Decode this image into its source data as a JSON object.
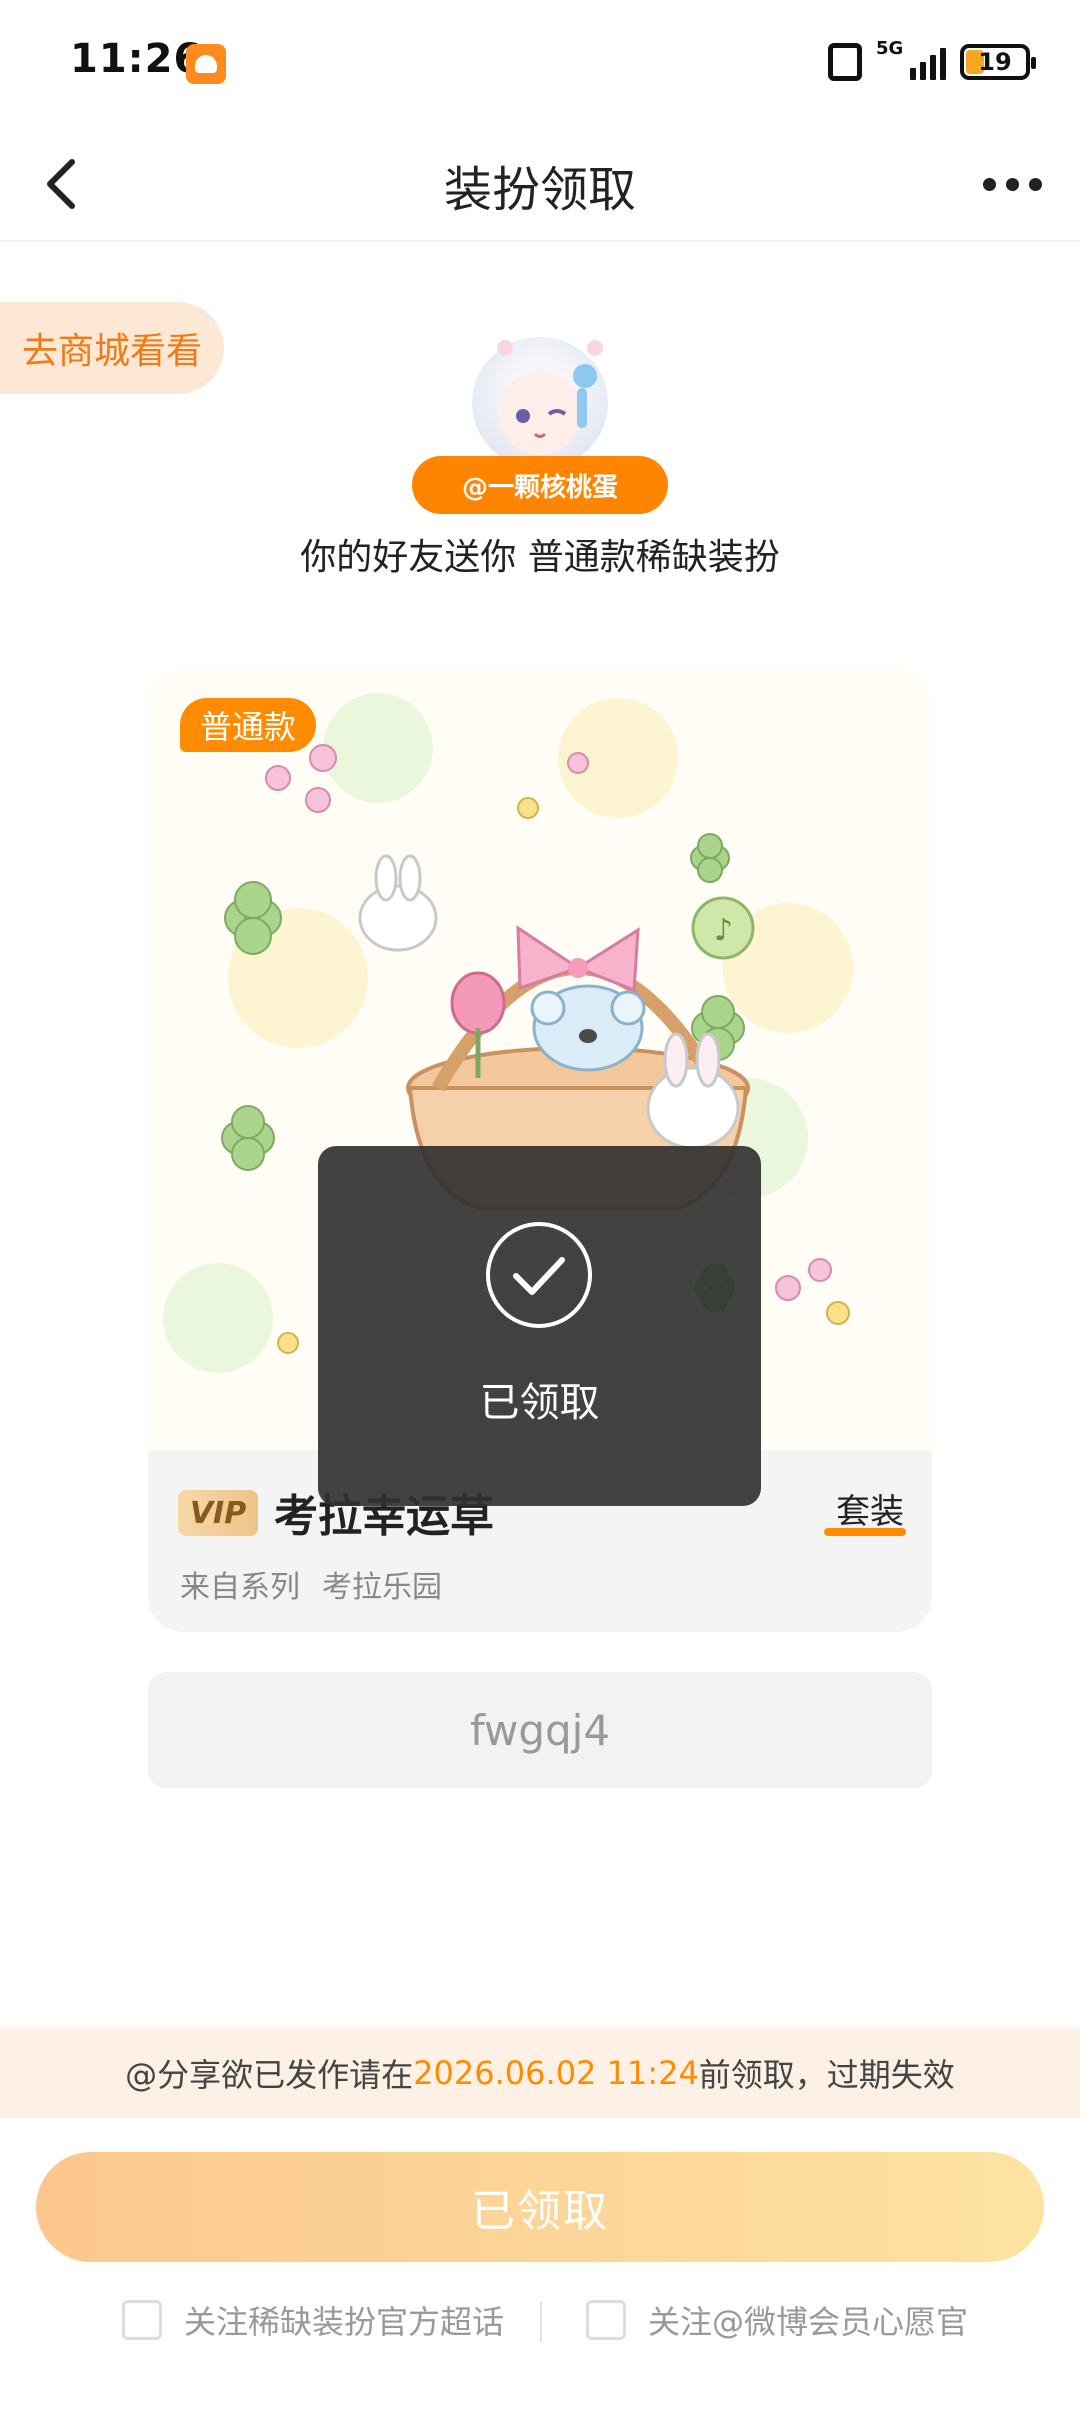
{
  "status_bar": {
    "time": "11:26",
    "network": "5G",
    "battery": "19",
    "icons": [
      "app-notification-icon",
      "vibrate-icon",
      "signal-icon",
      "battery-icon"
    ]
  },
  "header": {
    "title": "装扮领取",
    "back_icon": "back-arrow-icon",
    "more_icon": "more-dots-icon"
  },
  "store_link": {
    "label": "去商城看看"
  },
  "gift": {
    "sender": "@一颗核桃蛋",
    "message": "你的好友送你 普通款稀缺装扮"
  },
  "card": {
    "tag": "普通款",
    "vip_label": "VIP",
    "item_name": "考拉幸运草",
    "item_type": "套装",
    "series_label": "来自系列",
    "series_name": "考拉乐园"
  },
  "code": {
    "value": "fwgqj4"
  },
  "notice": {
    "prefix": "@分享欲已发作请在",
    "deadline": "2026.06.02 11:24",
    "suffix": "前领取，过期失效"
  },
  "claim_button": {
    "label": "已领取"
  },
  "follow": {
    "left_label": "关注稀缺装扮官方超话",
    "right_label": "关注@微博会员心愿官"
  },
  "toast": {
    "text": "已领取",
    "icon": "check-circle-icon"
  },
  "colors": {
    "accent": "#ff8c00",
    "notice_bg": "#fdf1e6",
    "button_gradient_start": "#fcc78e",
    "button_gradient_end": "#fde3a2"
  }
}
